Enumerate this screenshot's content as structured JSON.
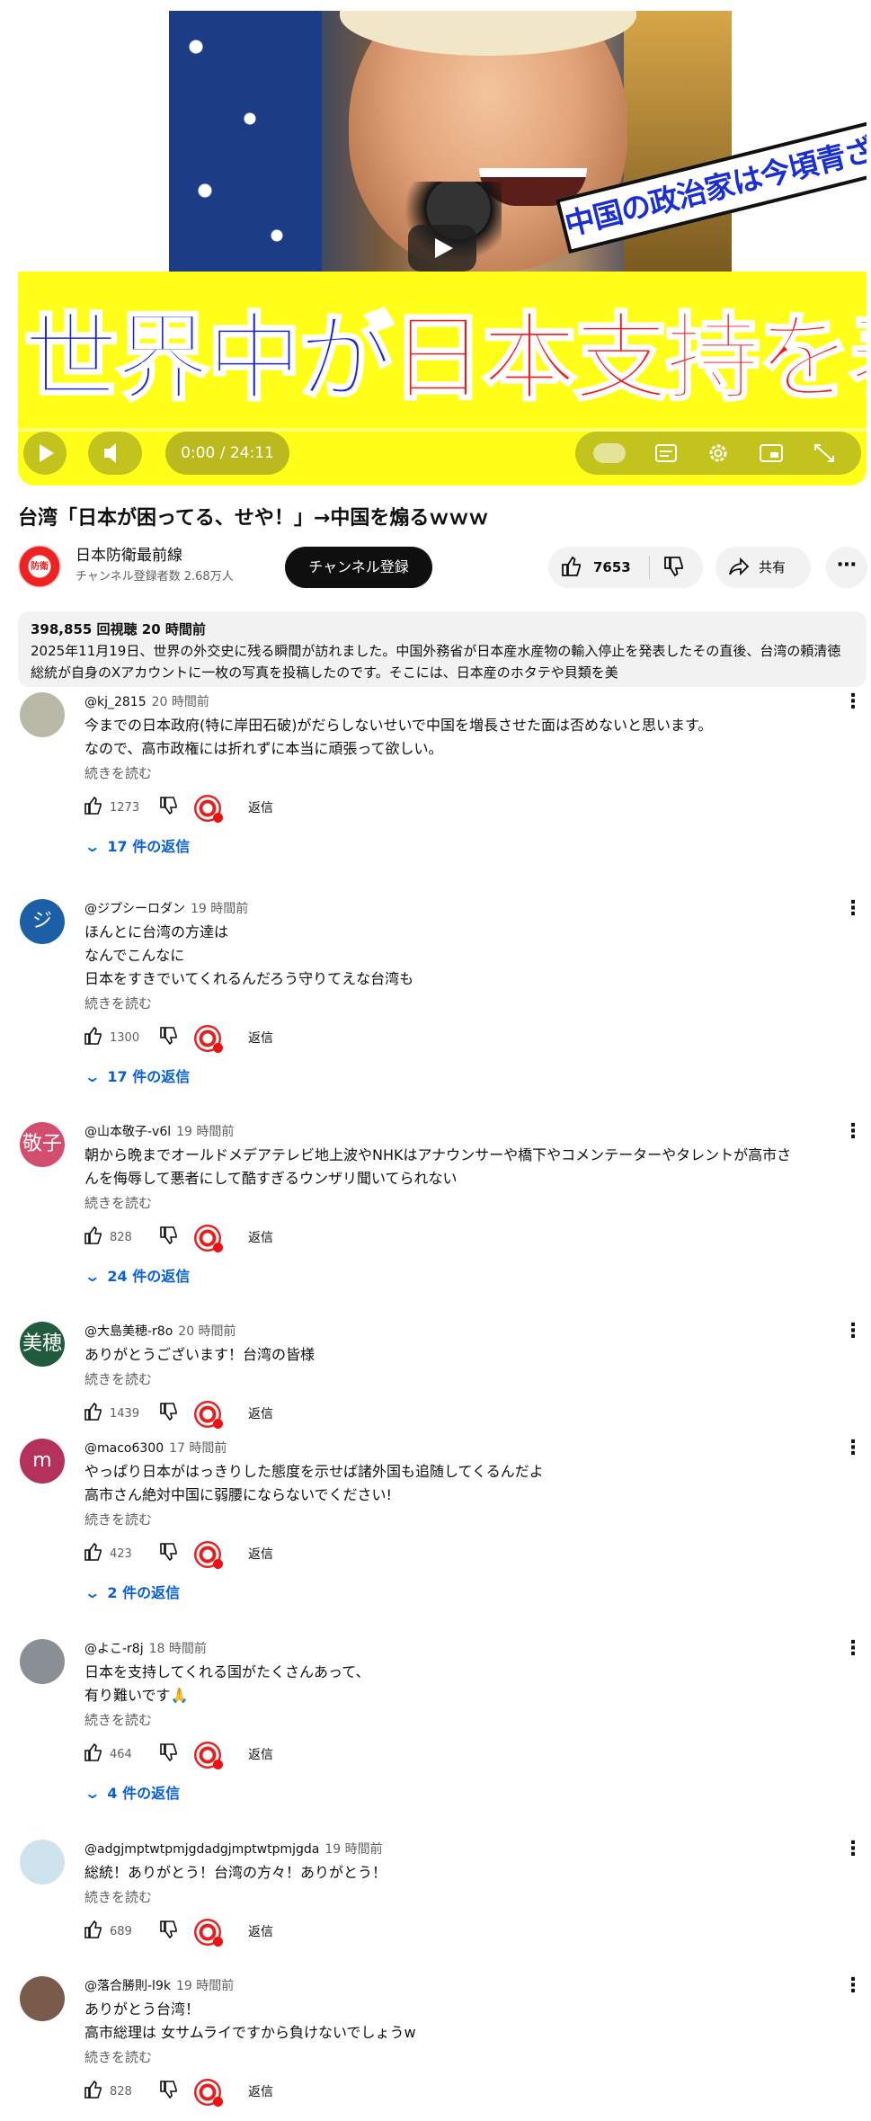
{
  "player": {
    "headline_blue": "世界中が",
    "headline_red": "日本支持を表明",
    "banner": "中国の政治家は今頃青ざめてる",
    "time": "0:00 / 24:11"
  },
  "video": {
    "title": "台湾「日本が困ってる、せや！」→中国を煽るｗｗｗ",
    "channel_avatar_text": "防衛",
    "channel_name": "日本防衛最前線",
    "channel_subs": "チャンネル登録者数 2.68万人",
    "subscribe_label": "チャンネル登録",
    "like_count": "7653",
    "share_label": "共有",
    "more_label": "⋯"
  },
  "description": {
    "stats": "398,855 回視聴  20 時間前",
    "text": "2025年11月19日、世界の外交史に残る瞬間が訪れました。中国外務省が日本産水産物の輸入停止を発表したその直後、台湾の頼清徳総統が自身のXアカウントに一枚の写真を投稿したのです。そこには、日本産のホタテや貝類を美"
  },
  "comments": [
    {
      "handle": "@kj_2815",
      "time": "20 時間前",
      "lines": [
        "今までの日本政府(特に岸田石破)がだらしないせいで中国を増長させた面は否めないと思います。",
        "なので、高市政権には折れずに本当に頑張って欲しい。"
      ],
      "read_more": "続きを読む",
      "likes": "1273",
      "reply": "返信",
      "replies": "17 件の返信",
      "avatar_text": "",
      "avatar_color": "#b9b9a8"
    },
    {
      "handle": "@ジプシーロダン",
      "time": "19 時間前",
      "lines": [
        "ほんとに台湾の方達は",
        "なんでこんなに",
        "日本をすきでいてくれるんだろう守りてえな台湾も"
      ],
      "read_more": "続きを読む",
      "likes": "1300",
      "reply": "返信",
      "replies": "17 件の返信",
      "avatar_text": "ジ",
      "avatar_color": "#1c5fa6"
    },
    {
      "handle": "@山本敬子-v6l",
      "time": "19 時間前",
      "lines": [
        "朝から晩までオールドメデアテレビ地上波やNHKはアナウンサーや橋下やコメンテーターやタレントが高市さ",
        "んを侮辱して悪者にして酷すぎるウンザリ聞いてられない"
      ],
      "read_more": "続きを読む",
      "likes": "828",
      "reply": "返信",
      "replies": "24 件の返信",
      "avatar_text": "敬子",
      "avatar_color": "#d24d6e"
    },
    {
      "handle": "@大島美穂-r8o",
      "time": "20 時間前",
      "lines": [
        "ありがとうございます！台湾の皆様"
      ],
      "read_more": "続きを読む",
      "likes": "1439",
      "reply": "返信",
      "replies": "",
      "avatar_text": "美穂",
      "avatar_color": "#1f5b3c"
    },
    {
      "handle": "@maco6300",
      "time": "17 時間前",
      "lines": [
        "やっぱり日本がはっきりした態度を示せば諸外国も追随してくるんだよ",
        "高市さん絶対中国に弱腰にならないでください!"
      ],
      "read_more": "続きを読む",
      "likes": "423",
      "reply": "返信",
      "replies": "2 件の返信",
      "avatar_text": "m",
      "avatar_color": "#b4315b"
    },
    {
      "handle": "@よこ-r8j",
      "time": "18 時間前",
      "lines": [
        "日本を支持してくれる国がたくさんあって、",
        "有り難いです🙏"
      ],
      "read_more": "続きを読む",
      "likes": "464",
      "reply": "返信",
      "replies": "4 件の返信",
      "avatar_text": "",
      "avatar_color": "#8a8f96"
    },
    {
      "handle": "@adgjmptwtpmjgdadgjmptwtpmjgda",
      "time": "19 時間前",
      "lines": [
        "総統！ありがとう！台湾の方々！ありがとう！"
      ],
      "read_more": "続きを読む",
      "likes": "689",
      "reply": "返信",
      "replies": "",
      "avatar_text": "",
      "avatar_color": "#cfe3ef"
    },
    {
      "handle": "@落合勝則-l9k",
      "time": "19 時間前",
      "lines": [
        "ありがとう台湾！",
        "高市総理は 女サムライですから負けないでしょうw"
      ],
      "read_more": "続きを読む",
      "likes": "828",
      "reply": "返信",
      "replies": "",
      "avatar_text": "",
      "avatar_color": "#7a5a4a"
    }
  ]
}
